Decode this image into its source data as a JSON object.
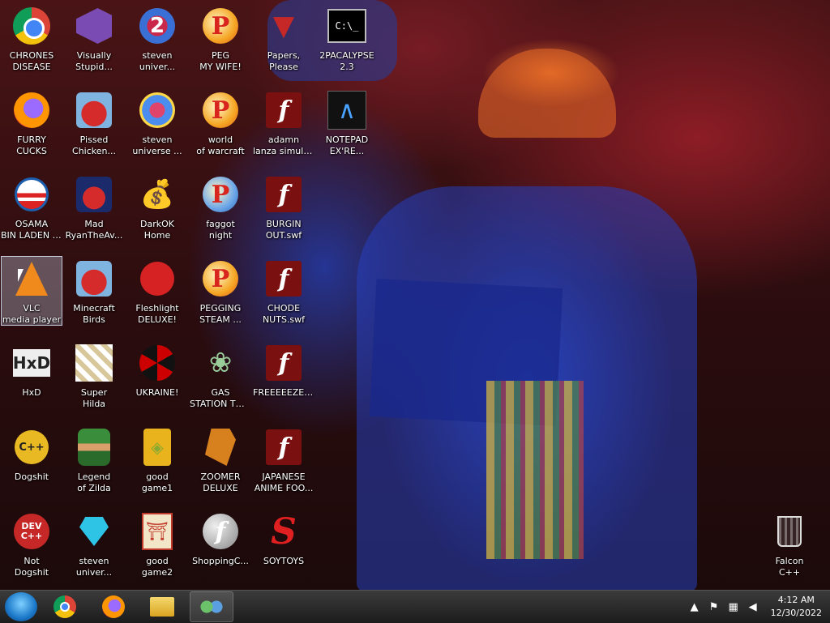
{
  "desktop": {
    "icons": [
      {
        "label": "CHRONES DISEASE",
        "icon": "chrome-icon"
      },
      {
        "label": "Visually Stupid...",
        "icon": "visual-studio-icon"
      },
      {
        "label": "steven univer...",
        "icon": "steven-universe-2-icon"
      },
      {
        "label": "PEG MY WIFE!",
        "icon": "pegging-ball-icon"
      },
      {
        "label": "Papers, Please",
        "icon": "papers-please-icon"
      },
      {
        "label": "2PACALYPSE 2.3",
        "icon": "command-prompt-icon"
      },
      {
        "label": "FURRY CUCKS",
        "icon": "firefox-icon"
      },
      {
        "label": "Pissed Chicken...",
        "icon": "angry-birds-seasons-icon"
      },
      {
        "label": "steven universe ...",
        "icon": "steven-universe-icon"
      },
      {
        "label": "world of warcraft",
        "icon": "pegging-ball-icon"
      },
      {
        "label": "adamn lanza simulator.swf",
        "icon": "flash-icon"
      },
      {
        "label": "NOTEPAD EX'RE...",
        "icon": "notepad-icon"
      },
      {
        "label": "OSAMA BIN LADEN BR...",
        "icon": "obama-logo-icon"
      },
      {
        "label": "Mad RyanTheAv...",
        "icon": "angry-birds-space-icon"
      },
      {
        "label": "DarkOK Home",
        "icon": "money-bag-icon"
      },
      {
        "label": "faggot night",
        "icon": "pegging-ball-icon"
      },
      {
        "label": "BURGIN OUT.swf",
        "icon": "flash-icon"
      },
      {
        "label": "VLC media player",
        "icon": "vlc-icon"
      },
      {
        "label": "Minecraft Birds",
        "icon": "angry-birds-icon"
      },
      {
        "label": "Fleshlight DELUXE!",
        "icon": "fleshlight-icon"
      },
      {
        "label": "PEGGING STEAM ...",
        "icon": "pegging-ball-icon"
      },
      {
        "label": "CHODE NUTS.swf",
        "icon": "flash-icon"
      },
      {
        "label": "HxD",
        "icon": "hxd-icon"
      },
      {
        "label": "Super Hilda",
        "icon": "hilda-icon"
      },
      {
        "label": "UKRAINE!",
        "icon": "radiation-icon"
      },
      {
        "label": "GAS STATION TWEAKERS",
        "icon": "flower-icon"
      },
      {
        "label": "FREEEEEZE.s...",
        "icon": "flash-icon"
      },
      {
        "label": "Dogshit",
        "icon": "cpp-icon"
      },
      {
        "label": "Legend of Zilda",
        "icon": "zelda-icon"
      },
      {
        "label": "good game1",
        "icon": "mahjong-icon"
      },
      {
        "label": "ZOOMER DELUXE",
        "icon": "zoomer-icon"
      },
      {
        "label": "JAPANESE ANIME FOO...",
        "icon": "flash-icon"
      },
      {
        "label": "Not Dogshit",
        "icon": "dev-cpp-icon"
      },
      {
        "label": "steven univer...",
        "icon": "gem-icon"
      },
      {
        "label": "good game2",
        "icon": "torii-icon"
      },
      {
        "label": "ShoppingC...",
        "icon": "flash-player-icon"
      },
      {
        "label": "SOYTOYS",
        "icon": "soytoys-icon"
      },
      {
        "label": "Falcon C++",
        "icon": "recycle-bin-icon"
      }
    ],
    "dev_text": [
      "DEV",
      "C++"
    ],
    "cpp_text": "C++",
    "hxd_text": "HxD",
    "cmd_text": "C:\\_"
  },
  "taskbar": {
    "clock_time": "4:12 AM",
    "clock_date": "12/30/2022"
  }
}
